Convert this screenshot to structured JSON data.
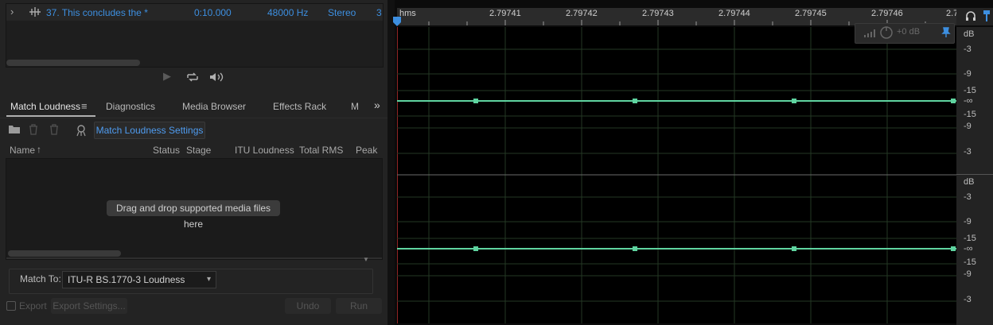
{
  "files": {
    "row": {
      "expand": "›",
      "name": "37. This concludes the *",
      "duration": "0:10.000",
      "sample_rate": "48000 Hz",
      "channels": "Stereo",
      "extra": "3"
    }
  },
  "tabs": {
    "match_loudness": "Match Loudness",
    "diagnostics": "Diagnostics",
    "media_browser": "Media Browser",
    "effects_rack": "Effects Rack",
    "more": "M"
  },
  "toolbar": {
    "settings_button": "Match Loudness Settings"
  },
  "columns": {
    "name": "Name",
    "status": "Status",
    "stage": "Stage",
    "itu": "ITU Loudness",
    "total_rms": "Total RMS",
    "peak": "Peak"
  },
  "queue": {
    "drop_message": "Drag and drop supported media files here"
  },
  "match": {
    "label": "Match To:",
    "value": "ITU-R BS.1770-3 Loudness"
  },
  "bottom": {
    "export_label": "Export",
    "export_settings": "Export Settings...",
    "undo": "Undo",
    "run": "Run"
  },
  "timeline": {
    "unit": "hms",
    "ticks": [
      "2.79741",
      "2.79742",
      "2.79743",
      "2.79744",
      "2.79745",
      "2.79746",
      "2.7"
    ]
  },
  "hud": {
    "gain": "+0 dB"
  },
  "db_scale": {
    "top": [
      "dB",
      "-3",
      "-9",
      "-15",
      "-∞",
      "-15",
      "-9",
      "-3"
    ],
    "bottom": [
      "dB",
      "-3",
      "-9",
      "-15",
      "-∞",
      "-15",
      "-9",
      "-3"
    ]
  },
  "colors": {
    "accent": "#3d8fe0",
    "waveform": "#5fd4a0",
    "background": "#0b0b0b"
  }
}
